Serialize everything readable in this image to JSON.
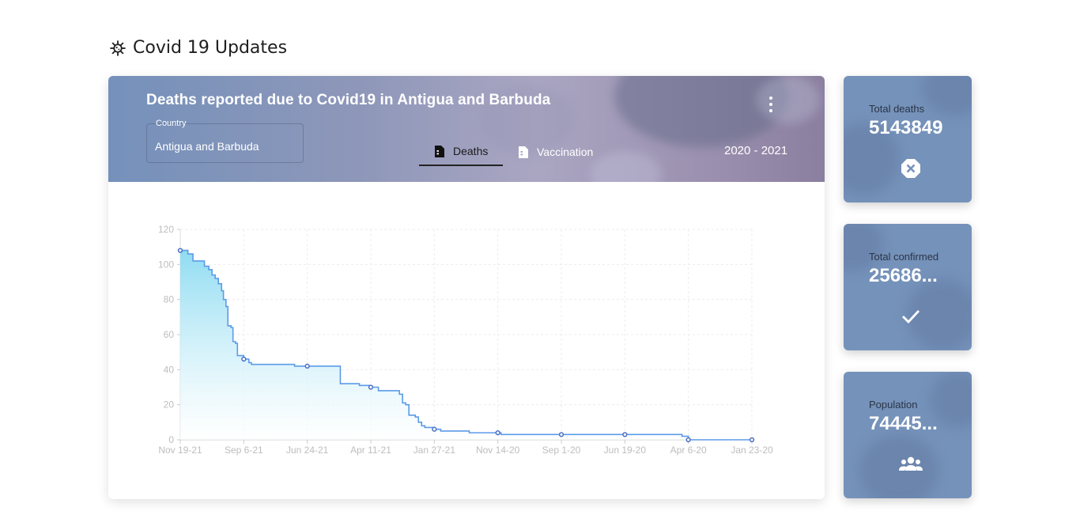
{
  "page": {
    "title": "Covid 19 Updates",
    "title_icon": "virus-icon"
  },
  "main_card": {
    "title": "Deaths reported due to Covid19 in Antigua and Barbuda",
    "menu_icon": "more-vert-icon",
    "country_field": {
      "label": "Country",
      "value": "Antigua and Barbuda"
    },
    "tabs": [
      {
        "label": "Deaths",
        "icon": "document-icon",
        "active": true
      },
      {
        "label": "Vaccination",
        "icon": "document-icon",
        "active": false
      }
    ],
    "year_range": "2020 - 2021"
  },
  "stats": [
    {
      "label": "Total deaths",
      "value": "5143849",
      "icon": "close-octagon-icon"
    },
    {
      "label": "Total confirmed",
      "value": "25686...",
      "icon": "check-icon"
    },
    {
      "label": "Population",
      "value": "74445...",
      "icon": "people-icon"
    }
  ],
  "colors": {
    "header_start": "#7591bb",
    "header_end": "#8b7f9f",
    "stat_card": "#7592ba",
    "line": "#5b9be8",
    "fill_top": "#8fdcf2",
    "fill_bottom": "#ffffff",
    "grid": "#ececec",
    "marker": "#4a6fc4"
  },
  "chart_data": {
    "type": "area",
    "title": "",
    "xlabel": "",
    "ylabel": "",
    "ylim": [
      0,
      120
    ],
    "yticks": [
      0,
      20,
      40,
      60,
      80,
      100,
      120
    ],
    "x_tick_labels": [
      "Nov 19-21",
      "Sep 6-21",
      "Jun 24-21",
      "Apr 11-21",
      "Jan 27-21",
      "Nov 14-20",
      "Sep 1-20",
      "Jun 19-20",
      "Apr 6-20",
      "Jan 23-20"
    ],
    "grid": true,
    "legend": "none",
    "markers": [
      {
        "x": "Nov 19-21",
        "y": 108
      },
      {
        "x": "Sep 6-21",
        "y": 46
      },
      {
        "x": "Jun 24-21",
        "y": 42
      },
      {
        "x": "Apr 11-21",
        "y": 30
      },
      {
        "x": "Jan 27-21",
        "y": 6
      },
      {
        "x": "Nov 14-20",
        "y": 4
      },
      {
        "x": "Sep 1-20",
        "y": 3
      },
      {
        "x": "Jun 19-20",
        "y": 3
      },
      {
        "x": "Apr 6-20",
        "y": 0
      },
      {
        "x": "Jan 23-20",
        "y": 0
      }
    ],
    "series": [
      {
        "values": [
          [
            0,
            108
          ],
          [
            0.12,
            106
          ],
          [
            0.2,
            102
          ],
          [
            0.3,
            102
          ],
          [
            0.38,
            99
          ],
          [
            0.45,
            97
          ],
          [
            0.5,
            94
          ],
          [
            0.55,
            92
          ],
          [
            0.6,
            89
          ],
          [
            0.65,
            85
          ],
          [
            0.68,
            80
          ],
          [
            0.72,
            76
          ],
          [
            0.75,
            65
          ],
          [
            0.8,
            64
          ],
          [
            0.83,
            56
          ],
          [
            0.87,
            55
          ],
          [
            0.9,
            48
          ],
          [
            1.0,
            46
          ],
          [
            1.08,
            44
          ],
          [
            1.12,
            43
          ],
          [
            1.5,
            43
          ],
          [
            1.8,
            42
          ],
          [
            2.5,
            42
          ],
          [
            2.52,
            32
          ],
          [
            2.8,
            32
          ],
          [
            2.82,
            31
          ],
          [
            3.0,
            30
          ],
          [
            3.1,
            30
          ],
          [
            3.12,
            28
          ],
          [
            3.4,
            28
          ],
          [
            3.45,
            26
          ],
          [
            3.5,
            21
          ],
          [
            3.55,
            20
          ],
          [
            3.6,
            14
          ],
          [
            3.7,
            13
          ],
          [
            3.75,
            10
          ],
          [
            3.8,
            8
          ],
          [
            3.85,
            7
          ],
          [
            3.9,
            7
          ],
          [
            4.0,
            6
          ],
          [
            4.1,
            5
          ],
          [
            4.2,
            5
          ],
          [
            4.5,
            5
          ],
          [
            4.55,
            4
          ],
          [
            5.0,
            4
          ],
          [
            5.05,
            3
          ],
          [
            6.0,
            3
          ],
          [
            7.0,
            3
          ],
          [
            7.8,
            3
          ],
          [
            7.9,
            2
          ],
          [
            8.0,
            0
          ],
          [
            9.0,
            0
          ]
        ]
      }
    ]
  }
}
